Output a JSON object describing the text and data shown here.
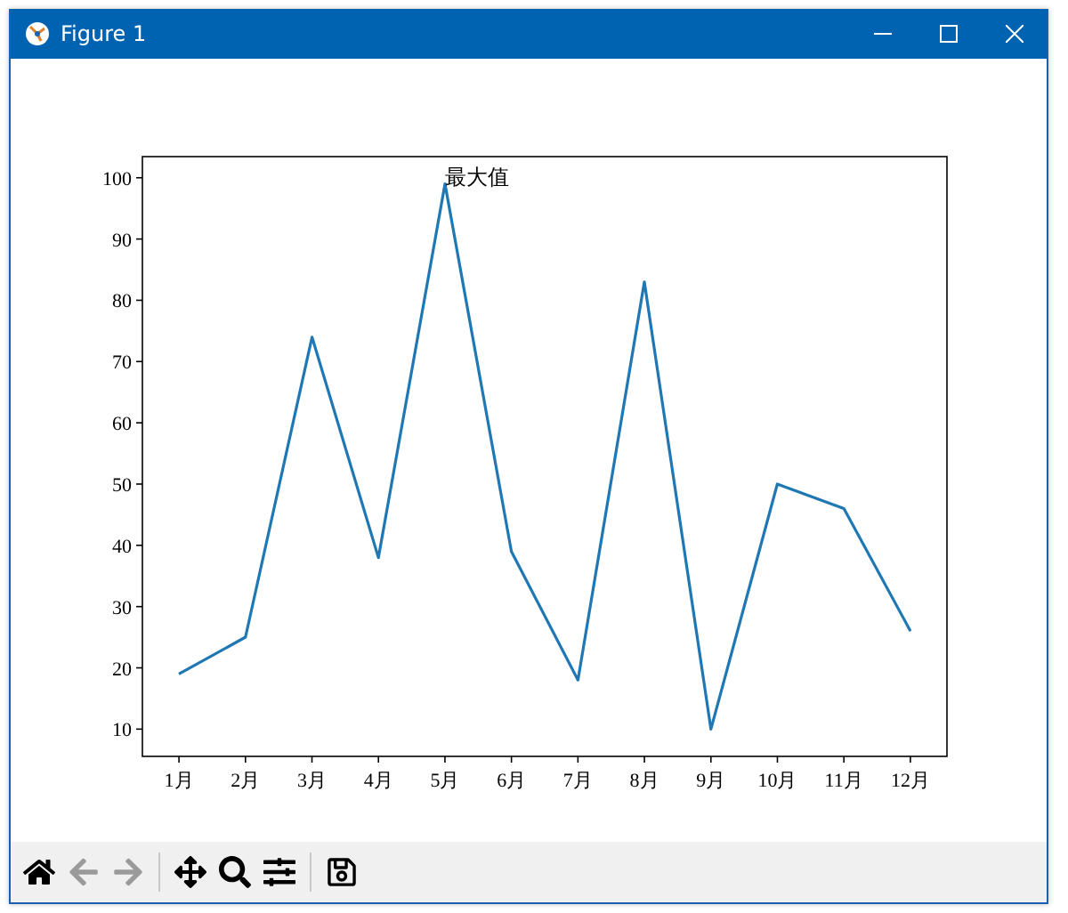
{
  "window": {
    "title": "Figure 1"
  },
  "figure": {
    "chart_data": {
      "type": "line",
      "categories": [
        "1月",
        "2月",
        "3月",
        "4月",
        "5月",
        "6月",
        "7月",
        "8月",
        "9月",
        "10月",
        "11月",
        "12月"
      ],
      "series": [
        {
          "color": "#1f77b4",
          "values": [
            19,
            25,
            74,
            38,
            99,
            39,
            18,
            83,
            10,
            50,
            46,
            26
          ]
        }
      ],
      "ylim": [
        5.55,
        103.45
      ],
      "yticks": [
        10,
        20,
        30,
        40,
        50,
        60,
        70,
        80,
        90,
        100
      ],
      "annotations": [
        {
          "text": "最大值"
        }
      ]
    }
  },
  "toolbar": {
    "tools": [
      {
        "kind": "home",
        "disabled": false
      },
      {
        "kind": "back",
        "disabled": true
      },
      {
        "kind": "forward",
        "disabled": true
      },
      {
        "kind": "separator"
      },
      {
        "kind": "pan",
        "disabled": false
      },
      {
        "kind": "zoom",
        "disabled": false
      },
      {
        "kind": "configure",
        "disabled": false
      },
      {
        "kind": "separator"
      },
      {
        "kind": "save",
        "disabled": false
      }
    ]
  }
}
